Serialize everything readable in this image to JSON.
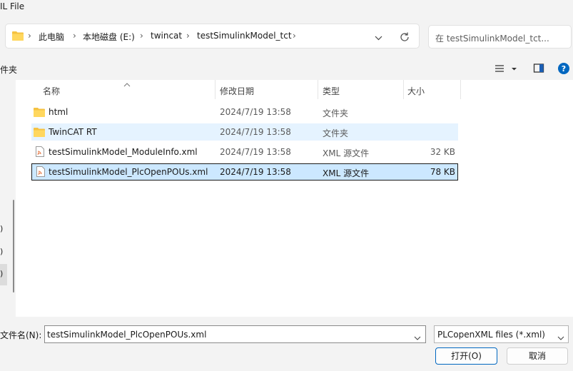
{
  "window": {
    "title": "IL File"
  },
  "address_bar": {
    "crumbs": [
      "此电脑",
      "本地磁盘 (E:)",
      "twincat",
      "testSimulinkModel_tct"
    ]
  },
  "search": {
    "placeholder": "在 testSimulinkModel_tct..."
  },
  "toolbar": {
    "left_label": "件夹"
  },
  "columns": {
    "name": "名称",
    "date": "修改日期",
    "type": "类型",
    "size": "大小"
  },
  "files": [
    {
      "name": "html",
      "date": "2024/7/19 13:58",
      "type": "文件夹",
      "size": "",
      "icon": "folder-icon"
    },
    {
      "name": "TwinCAT RT",
      "date": "2024/7/19 13:58",
      "type": "文件夹",
      "size": "",
      "icon": "folder-icon",
      "state": "hover"
    },
    {
      "name": "testSimulinkModel_ModuleInfo.xml",
      "date": "2024/7/19 13:58",
      "type": "XML 源文件",
      "size": "32 KB",
      "icon": "xml-file-icon"
    },
    {
      "name": "testSimulinkModel_PlcOpenPOUs.xml",
      "date": "2024/7/19 13:58",
      "type": "XML 源文件",
      "size": "78 KB",
      "icon": "xml-file-icon",
      "state": "selected"
    }
  ],
  "left_pane_fragments": [
    ")",
    ")",
    ")"
  ],
  "footer": {
    "filename_label": "文件名(N):",
    "filename_value": "testSimulinkModel_PlcOpenPOUs.xml",
    "filetype_value": "PLCopenXML files (*.xml)",
    "open_label": "打开(O)",
    "cancel_label": "取消"
  },
  "colors": {
    "accent": "#0067c0",
    "selected_row": "#cce8ff",
    "hover_row": "#e5f3ff",
    "folder": "#f5c242"
  }
}
